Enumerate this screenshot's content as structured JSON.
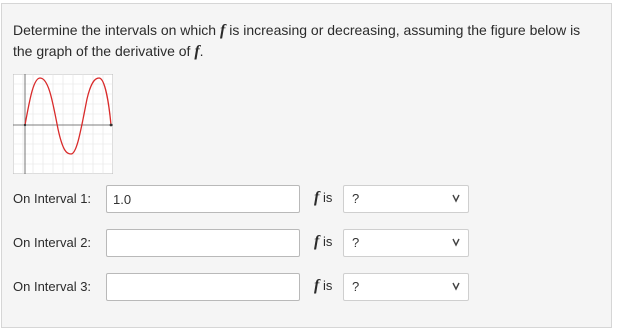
{
  "question": {
    "part1": "Determine the intervals on which ",
    "f_symbol": "f",
    "part2": " is increasing or decreasing, assuming the figure below is the graph of the derivative of ",
    "f_symbol_2": "f",
    "part3": "."
  },
  "graph": {
    "icon": "derivative-graph-thumbnail",
    "curve_color": "#d92b2b",
    "axis_color": "#555555",
    "grid_color": "#e3e3e3"
  },
  "intervals": [
    {
      "label": "On Interval 1:",
      "value": "1.0",
      "f_symbol": "f",
      "is_text": "is",
      "selected": "?"
    },
    {
      "label": "On Interval 2:",
      "value": "",
      "f_symbol": "f",
      "is_text": "is",
      "selected": "?"
    },
    {
      "label": "On Interval 3:",
      "value": "",
      "f_symbol": "f",
      "is_text": "is",
      "selected": "?"
    }
  ]
}
